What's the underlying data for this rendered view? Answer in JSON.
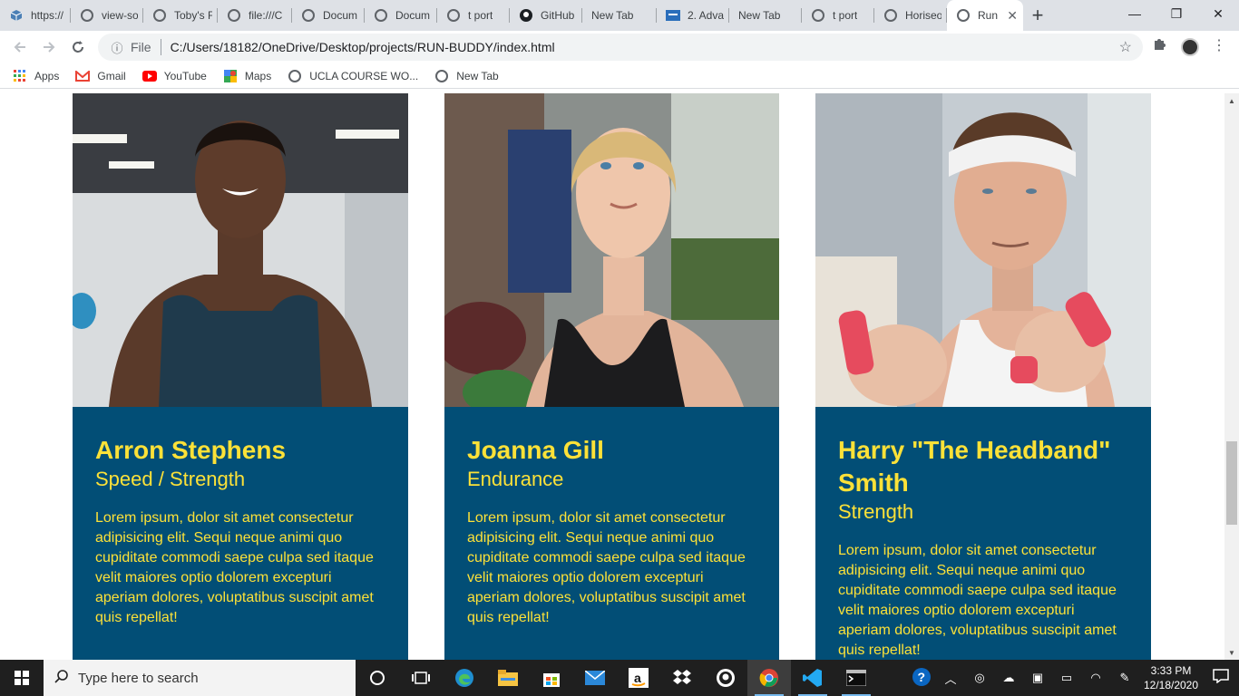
{
  "browser": {
    "tabs": [
      {
        "label": "https://",
        "icon": "cube-icon"
      },
      {
        "label": "view-so",
        "icon": "globe-icon"
      },
      {
        "label": "Toby's F",
        "icon": "globe-icon"
      },
      {
        "label": "file:///C",
        "icon": "globe-icon"
      },
      {
        "label": "Docum",
        "icon": "globe-icon"
      },
      {
        "label": "Docum",
        "icon": "globe-icon"
      },
      {
        "label": "t port",
        "icon": "globe-icon"
      },
      {
        "label": "GitHub",
        "icon": "github-icon"
      },
      {
        "label": "New Tab",
        "icon": "none"
      },
      {
        "label": "2. Adva",
        "icon": "doc-icon"
      },
      {
        "label": "New Tab",
        "icon": "none"
      },
      {
        "label": "t port",
        "icon": "globe-icon"
      },
      {
        "label": "Horiseo",
        "icon": "globe-icon"
      },
      {
        "label": "Run",
        "icon": "globe-icon",
        "active": true
      }
    ],
    "new_tab": "+",
    "window_controls": {
      "minimize": "—",
      "restore": "❐",
      "close": "✕"
    },
    "address": {
      "scheme": "File",
      "url": "C:/Users/18182/OneDrive/Desktop/projects/RUN-BUDDY/index.html"
    },
    "bookmarks": [
      {
        "label": "Apps",
        "icon": "apps-grid-icon"
      },
      {
        "label": "Gmail",
        "icon": "gmail-icon"
      },
      {
        "label": "YouTube",
        "icon": "youtube-icon"
      },
      {
        "label": "Maps",
        "icon": "maps-icon"
      },
      {
        "label": "UCLA COURSE WO...",
        "icon": "globe-icon"
      },
      {
        "label": "New Tab",
        "icon": "globe-icon"
      }
    ]
  },
  "page": {
    "trainers": [
      {
        "name": "Arron Stephens",
        "role": "Speed / Strength",
        "bio": "Lorem ipsum, dolor sit amet consectetur adipisicing elit. Sequi neque animi quo cupiditate commodi saepe culpa sed itaque velit maiores optio dolorem excepturi aperiam dolores, voluptatibus suscipit amet quis repellat!"
      },
      {
        "name": "Joanna Gill",
        "role": "Endurance",
        "bio": "Lorem ipsum, dolor sit amet consectetur adipisicing elit. Sequi neque animi quo cupiditate commodi saepe culpa sed itaque velit maiores optio dolorem excepturi aperiam dolores, voluptatibus suscipit amet quis repellat!"
      },
      {
        "name": "Harry \"The Headband\" Smith",
        "role": "Strength",
        "bio": "Lorem ipsum, dolor sit amet consectetur adipisicing elit. Sequi neque animi quo cupiditate commodi saepe culpa sed itaque velit maiores optio dolorem excepturi aperiam dolores, voluptatibus suscipit amet quis repellat!"
      }
    ],
    "colors": {
      "card_bg": "#024e76",
      "card_text": "#fce138"
    }
  },
  "taskbar": {
    "search_placeholder": "Type here to search",
    "time": "3:33 PM",
    "date": "12/18/2020"
  }
}
